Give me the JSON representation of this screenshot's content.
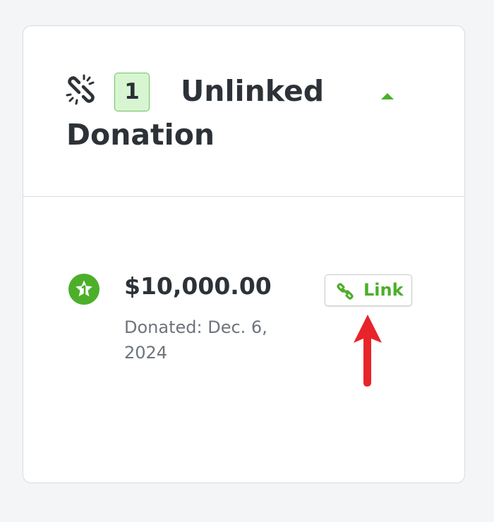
{
  "section": {
    "count": "1",
    "title_line1": "Unlinked",
    "title_line2": "Donation",
    "toggle_state": "expanded"
  },
  "icons": {
    "header": "unlink-icon",
    "toggle": "caret-up-icon",
    "donation": "star-badge-icon",
    "link_button": "chain-link-icon",
    "annotation": "red-arrow-up-icon"
  },
  "donation": {
    "amount": "$10,000.00",
    "date_text": "Donated: Dec. 6, 2024",
    "link_label": "Link"
  },
  "colors": {
    "accent_green": "#4caf2a",
    "badge_bg": "#d8f5d2",
    "badge_border": "#6cc35b",
    "text_dark": "#2d3238",
    "text_muted": "#6e747b",
    "annotation_red": "#e8242b"
  }
}
